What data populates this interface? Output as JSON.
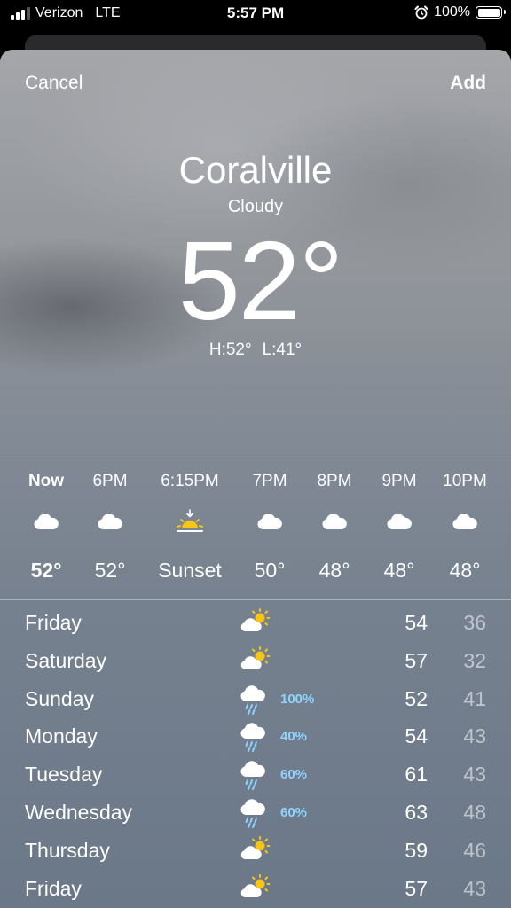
{
  "status_bar": {
    "carrier": "Verizon",
    "network": "LTE",
    "time": "5:57 PM",
    "battery": "100%"
  },
  "nav": {
    "cancel_label": "Cancel",
    "add_label": "Add"
  },
  "current": {
    "city": "Coralville",
    "condition": "Cloudy",
    "temperature": "52°",
    "high": "H:52°",
    "low": "L:41°"
  },
  "hourly": [
    {
      "label": "Now",
      "icon": "cloud-icon",
      "temp": "52°"
    },
    {
      "label": "6PM",
      "icon": "cloud-icon",
      "temp": "52°"
    },
    {
      "label": "6:15PM",
      "icon": "sunset-icon",
      "temp": "Sunset"
    },
    {
      "label": "7PM",
      "icon": "cloud-icon",
      "temp": "50°"
    },
    {
      "label": "8PM",
      "icon": "cloud-icon",
      "temp": "48°"
    },
    {
      "label": "9PM",
      "icon": "cloud-icon",
      "temp": "48°"
    },
    {
      "label": "10PM",
      "icon": "cloud-icon",
      "temp": "48°"
    }
  ],
  "daily": [
    {
      "day": "Friday",
      "icon": "partly-sunny-icon",
      "pop": "",
      "high": "54",
      "low": "36"
    },
    {
      "day": "Saturday",
      "icon": "partly-sunny-icon",
      "pop": "",
      "high": "57",
      "low": "32"
    },
    {
      "day": "Sunday",
      "icon": "rain-cloud-icon",
      "pop": "100%",
      "high": "52",
      "low": "41"
    },
    {
      "day": "Monday",
      "icon": "rain-cloud-icon",
      "pop": "40%",
      "high": "54",
      "low": "43"
    },
    {
      "day": "Tuesday",
      "icon": "rain-cloud-icon",
      "pop": "60%",
      "high": "61",
      "low": "43"
    },
    {
      "day": "Wednesday",
      "icon": "rain-cloud-icon",
      "pop": "60%",
      "high": "63",
      "low": "48"
    },
    {
      "day": "Thursday",
      "icon": "partly-sunny-icon",
      "pop": "",
      "high": "59",
      "low": "46"
    },
    {
      "day": "Friday",
      "icon": "partly-sunny-icon",
      "pop": "",
      "high": "57",
      "low": "43"
    }
  ],
  "colors": {
    "precip": "#8fd3ff",
    "sun": "#f5c518"
  }
}
